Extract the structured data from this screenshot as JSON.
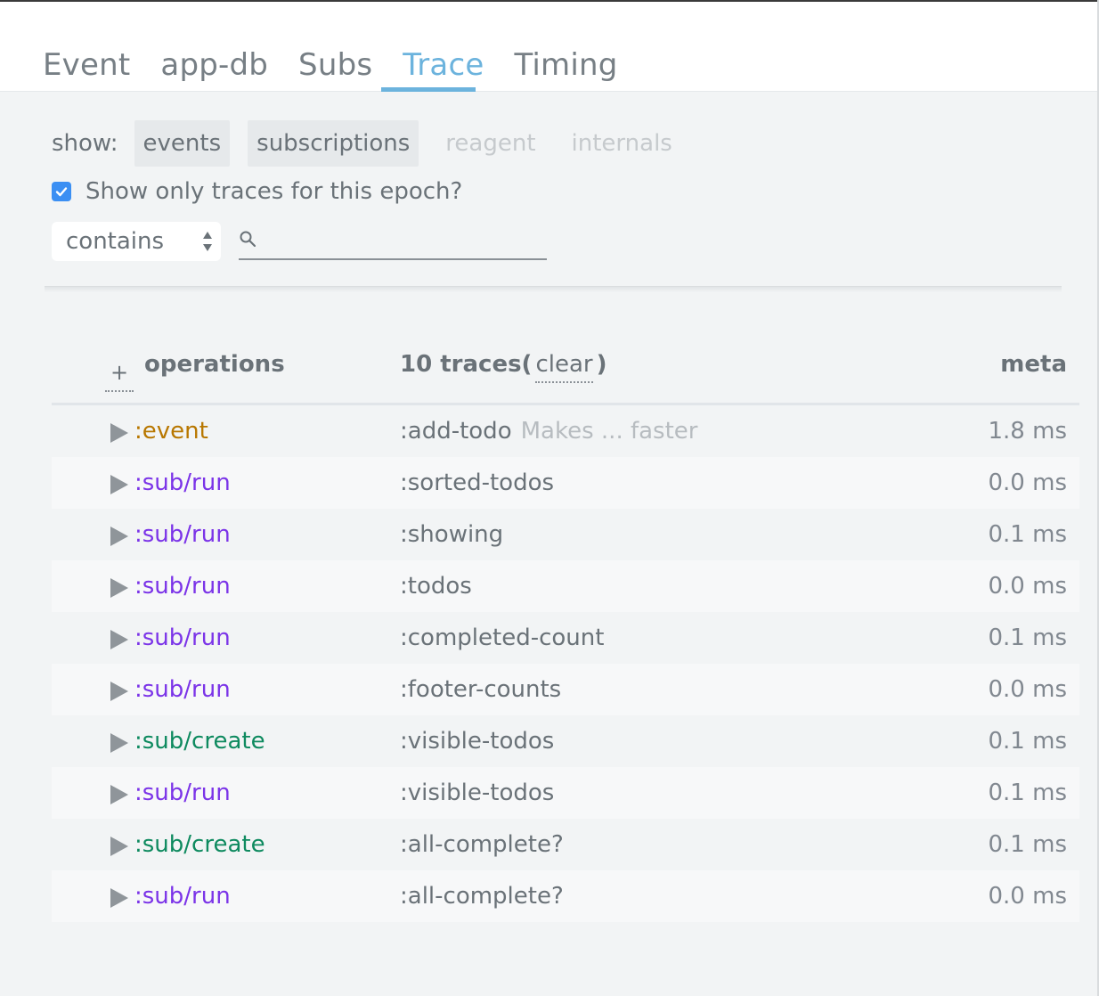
{
  "tabs": [
    {
      "label": "Event",
      "active": false
    },
    {
      "label": "app-db",
      "active": false
    },
    {
      "label": "Subs",
      "active": false
    },
    {
      "label": "Trace",
      "active": true
    },
    {
      "label": "Timing",
      "active": false
    }
  ],
  "filters": {
    "show_label": "show:",
    "buttons": [
      {
        "label": "events",
        "enabled": true
      },
      {
        "label": "subscriptions",
        "enabled": true
      },
      {
        "label": "reagent",
        "enabled": false
      },
      {
        "label": "internals",
        "enabled": false
      }
    ],
    "epoch_checkbox_label": "Show only traces for this epoch?",
    "epoch_checked": true
  },
  "search": {
    "mode": "contains",
    "value": ""
  },
  "table": {
    "expand_label": "+",
    "operations_header": "operations",
    "traces_header": "10 traces(",
    "clear_label": "clear",
    "traces_close": ")",
    "meta_header": "meta",
    "rows": [
      {
        "op": ":event",
        "kind": "event",
        "name": ":add-todo",
        "detail": "Makes ... faster",
        "meta": "1.8 ms"
      },
      {
        "op": ":sub/run",
        "kind": "run",
        "name": ":sorted-todos",
        "detail": "",
        "meta": "0.0 ms"
      },
      {
        "op": ":sub/run",
        "kind": "run",
        "name": ":showing",
        "detail": "",
        "meta": "0.1 ms"
      },
      {
        "op": ":sub/run",
        "kind": "run",
        "name": ":todos",
        "detail": "",
        "meta": "0.0 ms"
      },
      {
        "op": ":sub/run",
        "kind": "run",
        "name": ":completed-count",
        "detail": "",
        "meta": "0.1 ms"
      },
      {
        "op": ":sub/run",
        "kind": "run",
        "name": ":footer-counts",
        "detail": "",
        "meta": "0.0 ms"
      },
      {
        "op": ":sub/create",
        "kind": "create",
        "name": ":visible-todos",
        "detail": "",
        "meta": "0.1 ms"
      },
      {
        "op": ":sub/run",
        "kind": "run",
        "name": ":visible-todos",
        "detail": "",
        "meta": "0.1 ms"
      },
      {
        "op": ":sub/create",
        "kind": "create",
        "name": ":all-complete?",
        "detail": "",
        "meta": "0.1 ms"
      },
      {
        "op": ":sub/run",
        "kind": "run",
        "name": ":all-complete?",
        "detail": "",
        "meta": "0.0 ms"
      }
    ]
  },
  "colors": {
    "accent": "#6cb3dd",
    "event": "#b87700",
    "sub_run": "#7b34e8",
    "sub_create": "#0e8a5f",
    "checkbox": "#3b8ff3"
  }
}
